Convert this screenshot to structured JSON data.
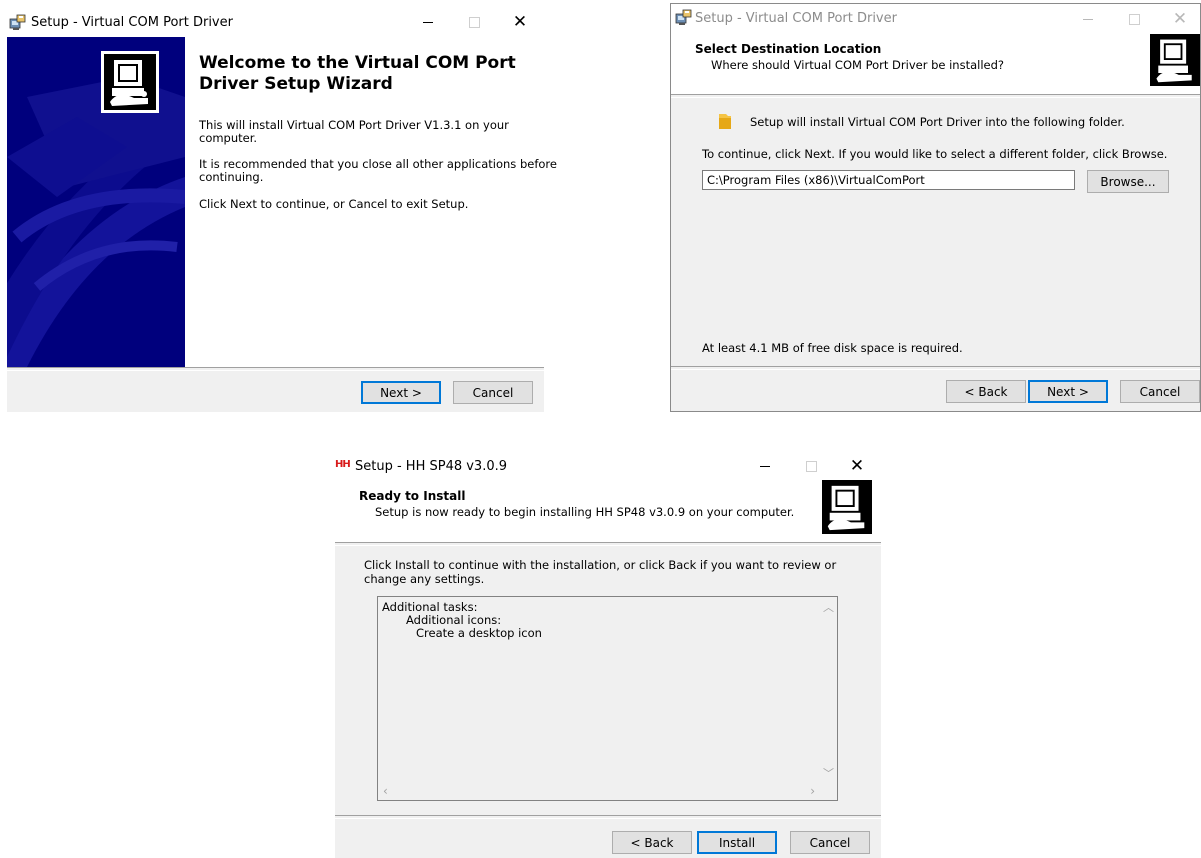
{
  "colors": {
    "accent": "#0078d7",
    "wizard_sidebar": "#00007d",
    "window_bg": "#f0f0f0"
  },
  "window1": {
    "title": "Setup - Virtual COM Port Driver",
    "heading_line1": "Welcome to the Virtual COM Port",
    "heading_line2": "Driver Setup Wizard",
    "para1_line1": "This will install Virtual COM Port Driver V1.3.1 on your",
    "para1_line2": "computer.",
    "para2_line1": "It is recommended that you close all other applications before",
    "para2_line2": "continuing.",
    "para3": "Click Next to continue, or Cancel to exit Setup.",
    "next_label": "Next >",
    "cancel_label": "Cancel",
    "icons": [
      "setup-app-icon",
      "minimize-icon",
      "maximize-icon",
      "close-icon",
      "wizard-computer-icon"
    ]
  },
  "window2": {
    "title": "Setup - Virtual COM Port Driver",
    "header_title": "Select Destination Location",
    "header_subtitle": "Where should Virtual COM Port Driver be installed?",
    "intro": "Setup will install Virtual COM Port Driver into the following folder.",
    "instruction": "To continue, click Next. If you would like to select a different folder, click Browse.",
    "path_value": "C:\\Program Files (x86)\\VirtualComPort",
    "browse_label": "Browse...",
    "disk_space": "At least 4.1 MB of free disk space is required.",
    "back_label": "< Back",
    "next_label": "Next >",
    "cancel_label": "Cancel",
    "icons": [
      "setup-app-icon",
      "folder-icon",
      "wizard-computer-icon"
    ]
  },
  "window3": {
    "title": "Setup - HH SP48 v3.0.9",
    "header_title": "Ready to Install",
    "header_subtitle": "Setup is now ready to begin installing HH SP48 v3.0.9 on your computer.",
    "intro_line1": "Click Install to continue with the installation, or click Back if you want to review or",
    "intro_line2": "change any settings.",
    "memo_line1": "Additional tasks:",
    "memo_line2": "Additional icons:",
    "memo_line3": "Create a desktop icon",
    "back_label": "< Back",
    "install_label": "Install",
    "cancel_label": "Cancel",
    "icons": [
      "app-logo-icon",
      "scroll-up-icon",
      "scroll-down-icon",
      "scroll-left-icon",
      "scroll-right-icon",
      "wizard-computer-icon"
    ]
  }
}
